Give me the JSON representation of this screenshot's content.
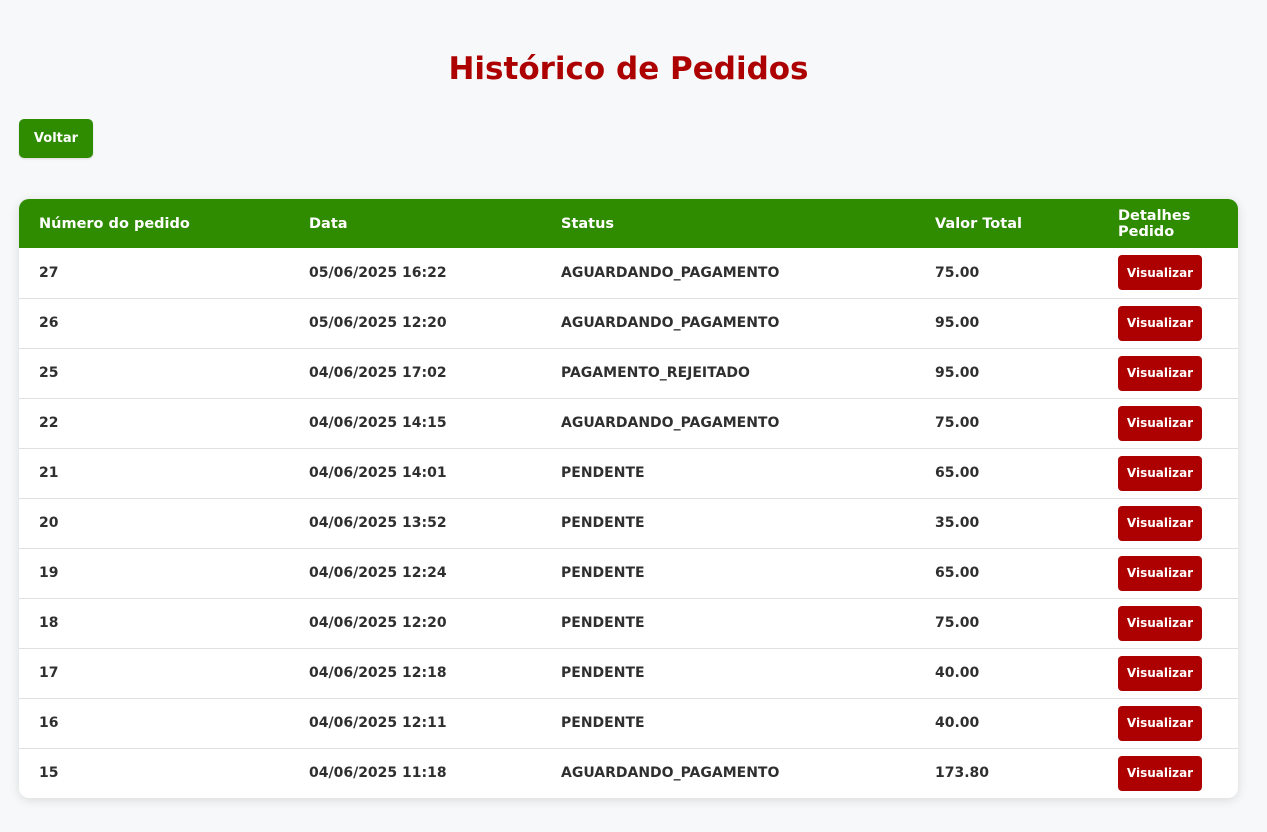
{
  "page": {
    "title": "Histórico de Pedidos",
    "back_label": "Voltar"
  },
  "colors": {
    "title": "#ad0000",
    "header_bg": "#2f8c00",
    "back_button": "#2f8c00",
    "view_button": "#ad0000",
    "background": "#f6f8f9"
  },
  "table": {
    "columns": [
      "Número do pedido",
      "Data",
      "Status",
      "Valor Total",
      "Detalhes Pedido"
    ],
    "rows": [
      {
        "number": "27",
        "date": "05/06/2025 16:22",
        "status": "AGUARDANDO_PAGAMENTO",
        "total": "75.00",
        "action": "Visualizar"
      },
      {
        "number": "26",
        "date": "05/06/2025 12:20",
        "status": "AGUARDANDO_PAGAMENTO",
        "total": "95.00",
        "action": "Visualizar"
      },
      {
        "number": "25",
        "date": "04/06/2025 17:02",
        "status": "PAGAMENTO_REJEITADO",
        "total": "95.00",
        "action": "Visualizar"
      },
      {
        "number": "22",
        "date": "04/06/2025 14:15",
        "status": "AGUARDANDO_PAGAMENTO",
        "total": "75.00",
        "action": "Visualizar"
      },
      {
        "number": "21",
        "date": "04/06/2025 14:01",
        "status": "PENDENTE",
        "total": "65.00",
        "action": "Visualizar"
      },
      {
        "number": "20",
        "date": "04/06/2025 13:52",
        "status": "PENDENTE",
        "total": "35.00",
        "action": "Visualizar"
      },
      {
        "number": "19",
        "date": "04/06/2025 12:24",
        "status": "PENDENTE",
        "total": "65.00",
        "action": "Visualizar"
      },
      {
        "number": "18",
        "date": "04/06/2025 12:20",
        "status": "PENDENTE",
        "total": "75.00",
        "action": "Visualizar"
      },
      {
        "number": "17",
        "date": "04/06/2025 12:18",
        "status": "PENDENTE",
        "total": "40.00",
        "action": "Visualizar"
      },
      {
        "number": "16",
        "date": "04/06/2025 12:11",
        "status": "PENDENTE",
        "total": "40.00",
        "action": "Visualizar"
      },
      {
        "number": "15",
        "date": "04/06/2025 11:18",
        "status": "AGUARDANDO_PAGAMENTO",
        "total": "173.80",
        "action": "Visualizar"
      }
    ]
  }
}
